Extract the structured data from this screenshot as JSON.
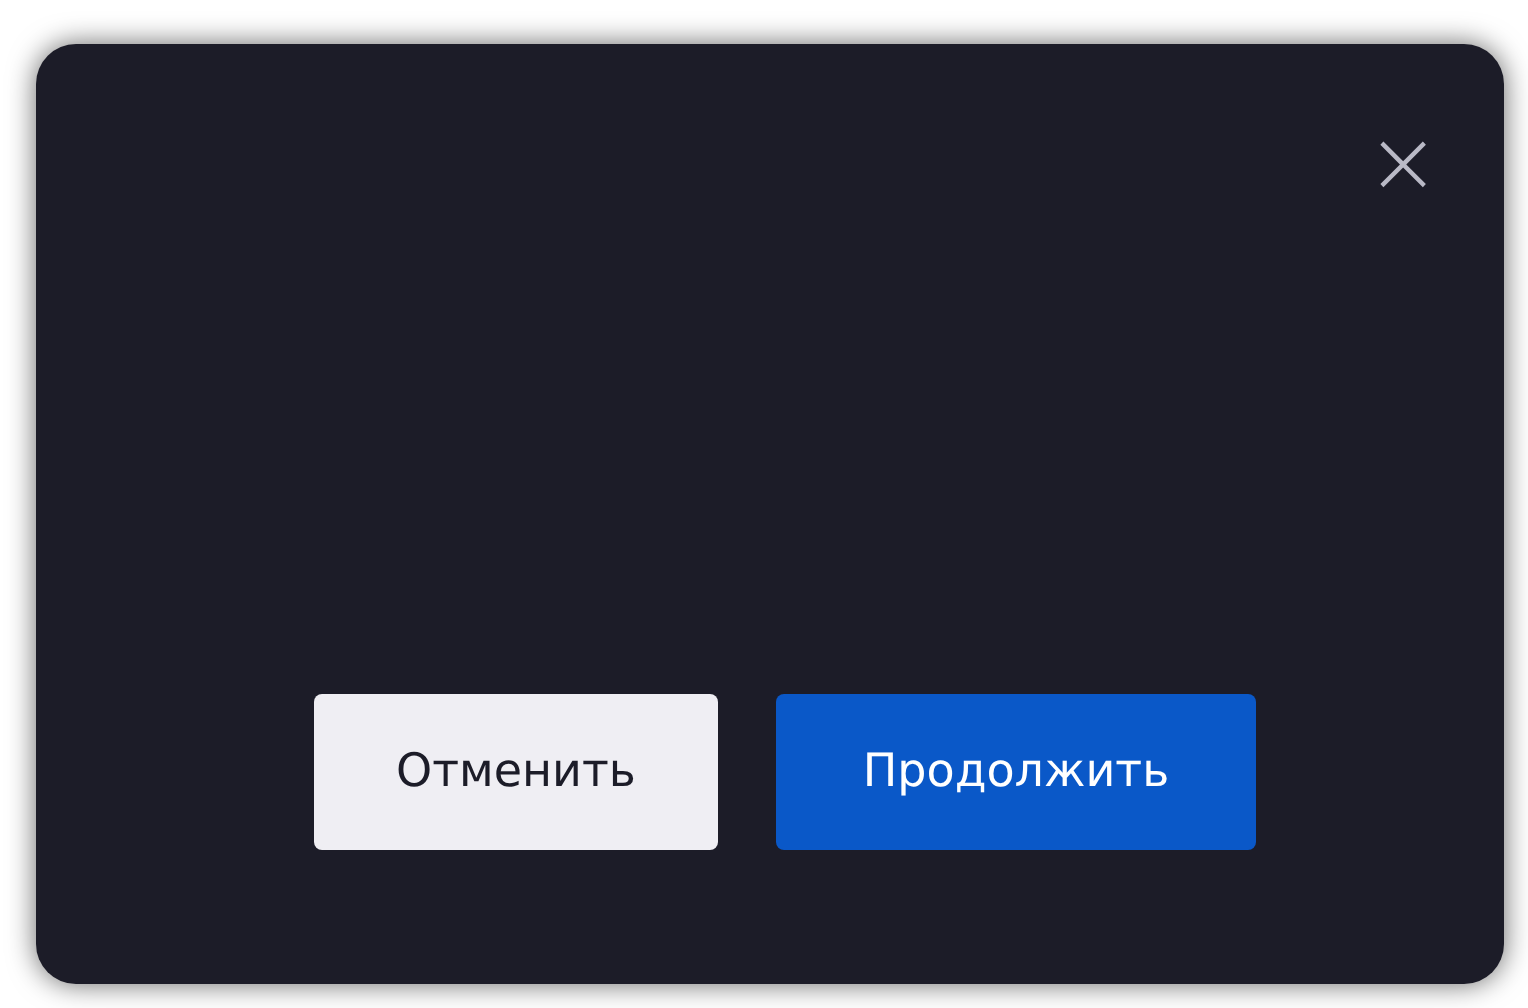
{
  "dialog": {
    "close_label": "×",
    "buttons": [
      {
        "label": "Отменить",
        "kind": "secondary"
      },
      {
        "label": "Продолжить",
        "kind": "primary"
      }
    ]
  }
}
